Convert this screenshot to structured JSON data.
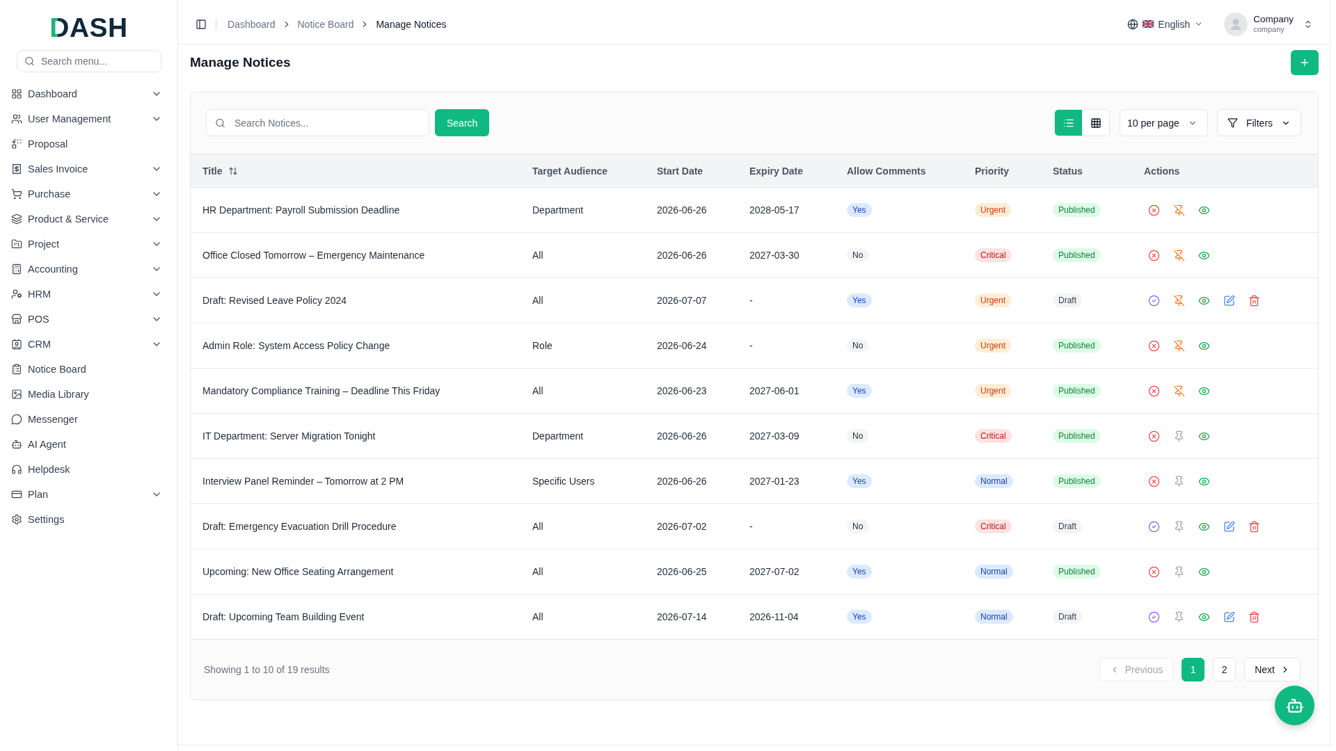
{
  "sidebar": {
    "logo": "DASH",
    "search": {
      "placeholder": "Search menu..."
    },
    "items": [
      {
        "label": "Dashboard",
        "expandable": true
      },
      {
        "label": "User Management",
        "expandable": true
      },
      {
        "label": "Proposal",
        "expandable": false
      },
      {
        "label": "Sales Invoice",
        "expandable": true
      },
      {
        "label": "Purchase",
        "expandable": true
      },
      {
        "label": "Product & Service",
        "expandable": true
      },
      {
        "label": "Project",
        "expandable": true
      },
      {
        "label": "Accounting",
        "expandable": true
      },
      {
        "label": "HRM",
        "expandable": true
      },
      {
        "label": "POS",
        "expandable": true
      },
      {
        "label": "CRM",
        "expandable": true
      },
      {
        "label": "Notice Board",
        "expandable": false
      },
      {
        "label": "Media Library",
        "expandable": false
      },
      {
        "label": "Messenger",
        "expandable": false
      },
      {
        "label": "AI Agent",
        "expandable": false
      },
      {
        "label": "Helpdesk",
        "expandable": false
      },
      {
        "label": "Plan",
        "expandable": true
      },
      {
        "label": "Settings",
        "expandable": false
      }
    ]
  },
  "topbar": {
    "breadcrumb": [
      "Dashboard",
      "Notice Board",
      "Manage Notices"
    ],
    "language": "English",
    "user": {
      "name": "Company",
      "role": "company"
    }
  },
  "page": {
    "title": "Manage Notices"
  },
  "toolbar": {
    "search": {
      "placeholder": "Search Notices...",
      "button": "Search"
    },
    "view_modes": [
      {
        "selected": true
      },
      {
        "selected": false
      }
    ],
    "per_page": "10 per page",
    "filters": "Filters"
  },
  "table": {
    "columns": [
      {
        "label": "Title",
        "sortable": true
      },
      {
        "label": "Target Audience",
        "sortable": false
      },
      {
        "label": "Start Date",
        "sortable": false
      },
      {
        "label": "Expiry Date",
        "sortable": false
      },
      {
        "label": "Allow Comments",
        "sortable": false
      },
      {
        "label": "Priority",
        "sortable": false
      },
      {
        "label": "Status",
        "sortable": false
      },
      {
        "label": "Actions",
        "sortable": false
      }
    ],
    "rows": [
      {
        "title": "HR Department: Payroll Submission Deadline",
        "audience": "Department",
        "start_date": "2026-06-26",
        "expiry_date": "2028-05-17",
        "allow_comments": {
          "label": "Yes",
          "allowed": true
        },
        "priority": {
          "label": "Urgent",
          "kind": "urgent"
        },
        "status": {
          "label": "Published",
          "published": true
        },
        "pinned": true
      },
      {
        "title": "Office Closed Tomorrow – Emergency Maintenance",
        "audience": "All",
        "start_date": "2026-06-26",
        "expiry_date": "2027-03-30",
        "allow_comments": {
          "label": "No",
          "allowed": false
        },
        "priority": {
          "label": "Critical",
          "kind": "critical"
        },
        "status": {
          "label": "Published",
          "published": true
        },
        "pinned": true
      },
      {
        "title": "Draft: Revised Leave Policy 2024",
        "audience": "All",
        "start_date": "2026-07-07",
        "expiry_date": "-",
        "allow_comments": {
          "label": "Yes",
          "allowed": true
        },
        "priority": {
          "label": "Urgent",
          "kind": "urgent"
        },
        "status": {
          "label": "Draft",
          "published": false
        },
        "pinned": true
      },
      {
        "title": "Admin Role: System Access Policy Change",
        "audience": "Role",
        "start_date": "2026-06-24",
        "expiry_date": "-",
        "allow_comments": {
          "label": "No",
          "allowed": false
        },
        "priority": {
          "label": "Urgent",
          "kind": "urgent"
        },
        "status": {
          "label": "Published",
          "published": true
        },
        "pinned": true
      },
      {
        "title": "Mandatory Compliance Training – Deadline This Friday",
        "audience": "All",
        "start_date": "2026-06-23",
        "expiry_date": "2027-06-01",
        "allow_comments": {
          "label": "Yes",
          "allowed": true
        },
        "priority": {
          "label": "Urgent",
          "kind": "urgent"
        },
        "status": {
          "label": "Published",
          "published": true
        },
        "pinned": true
      },
      {
        "title": "IT Department: Server Migration Tonight",
        "audience": "Department",
        "start_date": "2026-06-26",
        "expiry_date": "2027-03-09",
        "allow_comments": {
          "label": "No",
          "allowed": false
        },
        "priority": {
          "label": "Critical",
          "kind": "critical"
        },
        "status": {
          "label": "Published",
          "published": true
        },
        "pinned": false
      },
      {
        "title": "Interview Panel Reminder – Tomorrow at 2 PM",
        "audience": "Specific Users",
        "start_date": "2026-06-26",
        "expiry_date": "2027-01-23",
        "allow_comments": {
          "label": "Yes",
          "allowed": true
        },
        "priority": {
          "label": "Normal",
          "kind": "normal"
        },
        "status": {
          "label": "Published",
          "published": true
        },
        "pinned": false
      },
      {
        "title": "Draft: Emergency Evacuation Drill Procedure",
        "audience": "All",
        "start_date": "2026-07-02",
        "expiry_date": "-",
        "allow_comments": {
          "label": "No",
          "allowed": false
        },
        "priority": {
          "label": "Critical",
          "kind": "critical"
        },
        "status": {
          "label": "Draft",
          "published": false
        },
        "pinned": false
      },
      {
        "title": "Upcoming: New Office Seating Arrangement",
        "audience": "All",
        "start_date": "2026-06-25",
        "expiry_date": "2027-07-02",
        "allow_comments": {
          "label": "Yes",
          "allowed": true
        },
        "priority": {
          "label": "Normal",
          "kind": "normal"
        },
        "status": {
          "label": "Published",
          "published": true
        },
        "pinned": false
      },
      {
        "title": "Draft: Upcoming Team Building Event",
        "audience": "All",
        "start_date": "2026-07-14",
        "expiry_date": "2026-11-04",
        "allow_comments": {
          "label": "Yes",
          "allowed": true
        },
        "priority": {
          "label": "Normal",
          "kind": "normal"
        },
        "status": {
          "label": "Draft",
          "published": false
        },
        "pinned": false
      }
    ]
  },
  "pagination": {
    "summary": "Showing 1 to 10 of 19 results",
    "previous": {
      "label": "Previous",
      "disabled": true
    },
    "pages": [
      {
        "label": "1",
        "selected": true
      },
      {
        "label": "2",
        "selected": false
      }
    ],
    "next": {
      "label": "Next",
      "disabled": false
    }
  }
}
